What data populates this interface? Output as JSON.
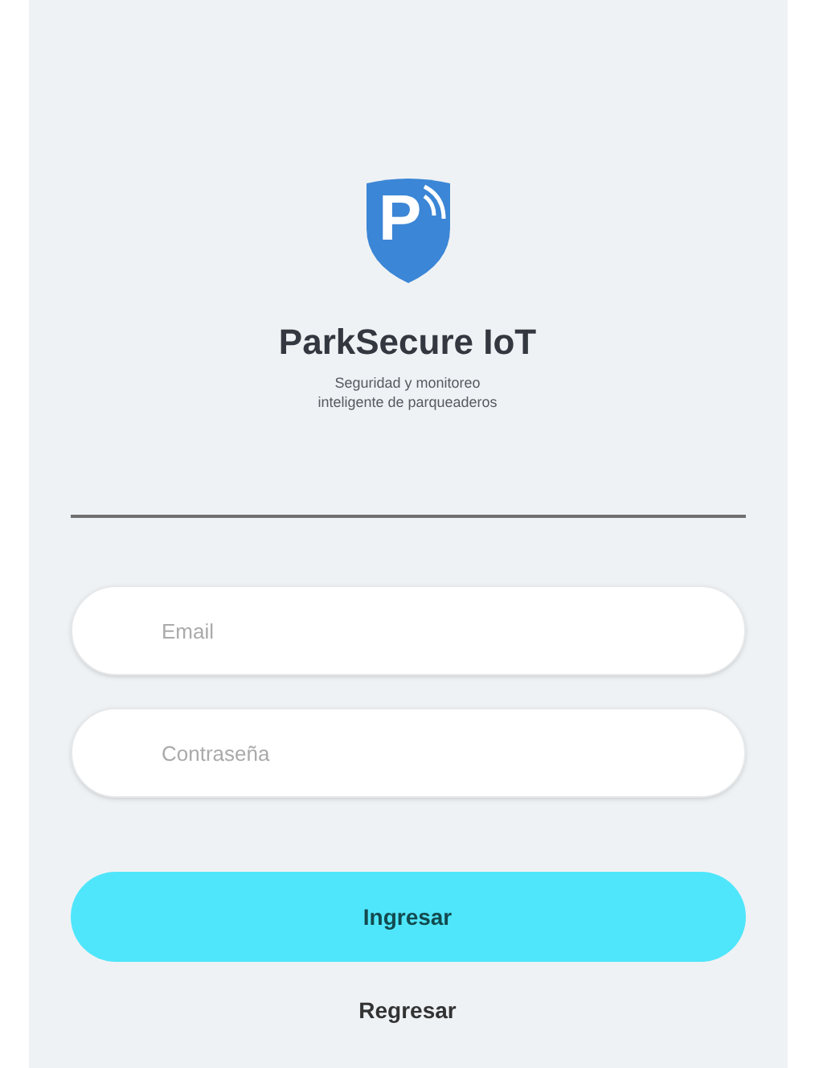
{
  "brand": {
    "title": "ParkSecure IoT",
    "subtitle": "Seguridad y monitoreo inteligente de parqueaderos",
    "logo_letter": "P"
  },
  "fields": [
    {
      "placeholder": "Email"
    },
    {
      "placeholder": "Contraseña"
    }
  ],
  "submit_button": "Ingresar",
  "back_link": "Regresar"
}
